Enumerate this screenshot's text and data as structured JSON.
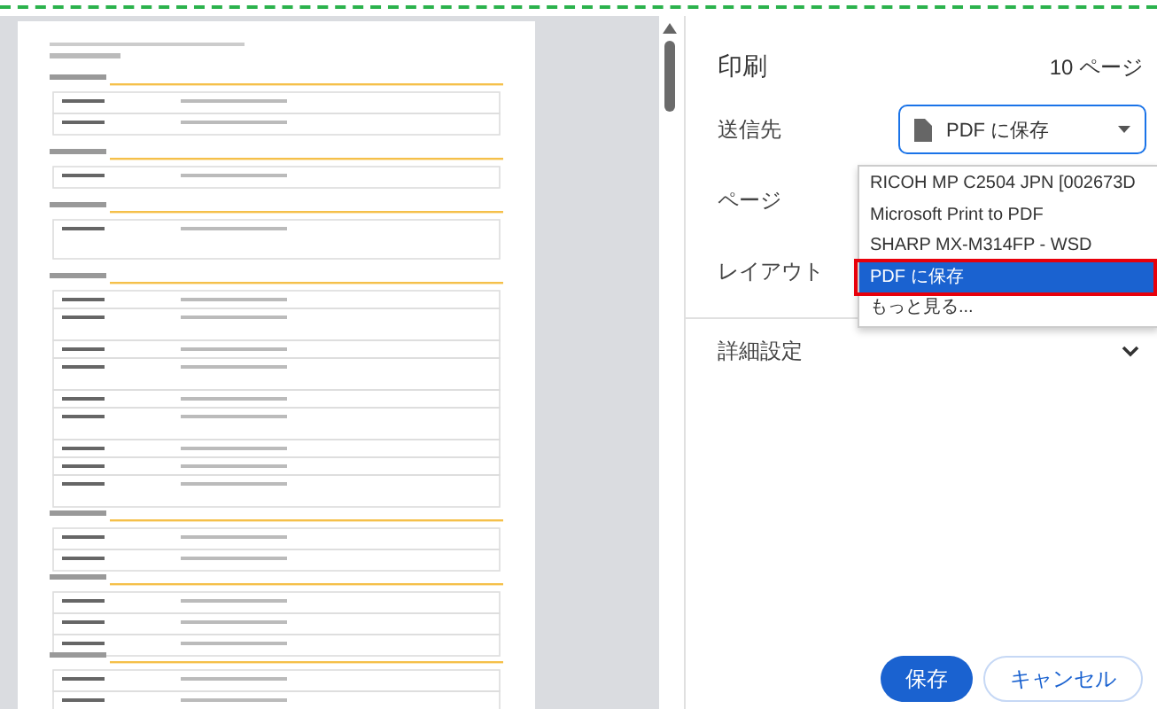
{
  "header": {
    "title": "印刷",
    "page_count": "10 ページ"
  },
  "settings": [
    {
      "label": "送信先",
      "kind": "select",
      "value": "PDF に保存"
    },
    {
      "label": "ページ",
      "kind": "blank"
    },
    {
      "label": "レイアウト",
      "kind": "blank"
    }
  ],
  "destination_menu": {
    "items": [
      {
        "label": "RICOH MP C2504 JPN [002673D",
        "selected": false,
        "highlighted": false
      },
      {
        "label": "Microsoft Print to PDF",
        "selected": false,
        "highlighted": false
      },
      {
        "label": "SHARP MX-M314FP - WSD",
        "selected": false,
        "highlighted": false
      },
      {
        "label": "PDF に保存",
        "selected": true,
        "highlighted": true
      },
      {
        "label": "もっと見る...",
        "selected": false,
        "highlighted": false
      }
    ]
  },
  "more_settings": {
    "label": "詳細設定",
    "expanded": false
  },
  "buttons": [
    {
      "label": "保存",
      "kind": "primary"
    },
    {
      "label": "キャンセル",
      "kind": "secondary"
    }
  ]
}
